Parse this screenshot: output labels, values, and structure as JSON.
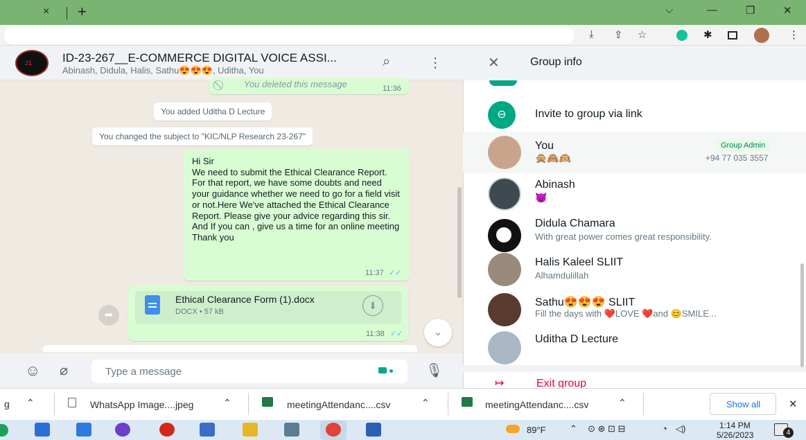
{
  "browser": {
    "tab_close": "×",
    "new_tab": "+",
    "toolbar_icons": [
      "install-icon",
      "share-icon",
      "star-icon",
      "grammarly-icon",
      "extensions-icon",
      "sidepanel-icon",
      "profile-icon",
      "menu-icon"
    ]
  },
  "chat": {
    "title": "ID-23-267__E-COMMERCE DIGITAL VOICE ASSI...",
    "members": "Abinash, Didula, Halis, Sathu😍😍😍, Uditha, You",
    "deleted_message": "You deleted this message",
    "deleted_time": "11:36",
    "system_1": "You added Uditha D Lecture",
    "system_2": "You changed the subject to \"KIC/NLP Research 23-267\"",
    "message_text": "Hi Sir\nWe need to submit the Ethical Clearance Report. For that report, we have some doubts and need your guidance whether we need to go for a field visit or not.Here We've attached the Ethical Clearance Report. Please give your advice regarding this sir. And If you can , give us a time for an online meeting\nThank you",
    "message_time": "11:37",
    "file_name": "Ethical Clearance Form (1).docx",
    "file_meta": "DOCX • 57 kB",
    "file_time": "11:38",
    "composer_placeholder": "Type a message"
  },
  "group_info": {
    "title": "Group info",
    "invite_label": "Invite to group via link",
    "participants": [
      {
        "name": "You",
        "about": "🙊🙈🙉",
        "badge": "Group Admin",
        "phone": "+94 77 035 3557"
      },
      {
        "name": "Abinash",
        "about": "😈"
      },
      {
        "name": "Didula Chamara",
        "about": "With great power comes great responsibility."
      },
      {
        "name": "Halis Kaleel SLIIT",
        "about": "Alhamdulillah"
      },
      {
        "name": "Sathu😍😍😍 SLIIT",
        "about": "Fill the days with ❤️LOVE ❤️and 😊SMILE..."
      },
      {
        "name": "Uditha D Lecture",
        "about": ""
      }
    ],
    "exit_label": "Exit group"
  },
  "downloads": {
    "items": [
      {
        "name": "WhatsApp Image....jpeg"
      },
      {
        "name": "meetingAttendanc....csv"
      },
      {
        "name": "meetingAttendanc....csv"
      }
    ],
    "show_all": "Show all"
  },
  "taskbar": {
    "weather": "89°F",
    "time": "1:14 PM",
    "date": "5/26/2023",
    "notifications": "4"
  },
  "colors": {
    "accent": "#00a884",
    "tab_strip": "#79b473",
    "bubble_out": "#d9fdd3",
    "exit": "#ea0038"
  }
}
